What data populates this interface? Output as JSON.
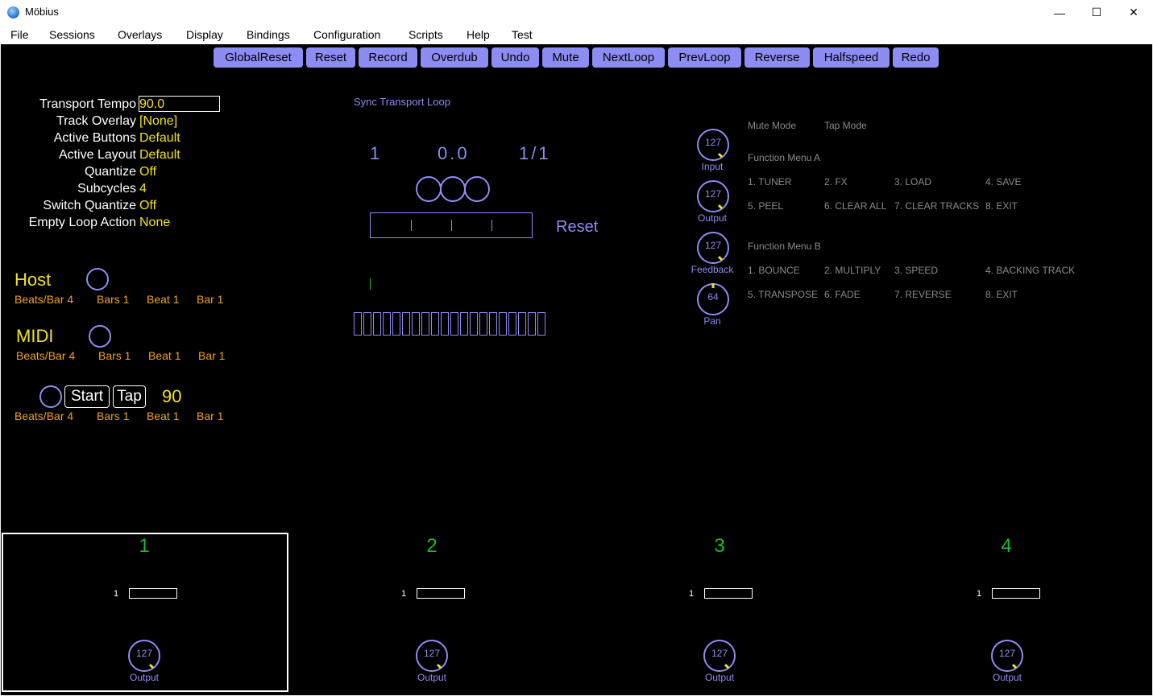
{
  "window": {
    "title": "Möbius",
    "minimize": "—",
    "maximize": "☐",
    "close": "✕"
  },
  "menu": [
    "File",
    "Sessions",
    "Overlays",
    "Display",
    "Bindings",
    "Configuration",
    "Scripts",
    "Help",
    "Test"
  ],
  "buttons": [
    "GlobalReset",
    "Reset",
    "Record",
    "Overdub",
    "Undo",
    "Mute",
    "NextLoop",
    "PrevLoop",
    "Reverse",
    "Halfspeed",
    "Redo"
  ],
  "params": [
    {
      "label": "Transport Tempo",
      "value": "90.0"
    },
    {
      "label": "Track Overlay",
      "value": "[None]"
    },
    {
      "label": "Active Buttons",
      "value": "Default"
    },
    {
      "label": "Active Layout",
      "value": "Default"
    },
    {
      "label": "Quantize",
      "value": "Off"
    },
    {
      "label": "Subcycles",
      "value": "4"
    },
    {
      "label": "Switch Quantize",
      "value": "Off"
    },
    {
      "label": "Empty Loop Action",
      "value": "None"
    }
  ],
  "sync": {
    "host": {
      "title": "Host",
      "beats_per_bar": "Beats/Bar 4",
      "bars": "Bars 1",
      "beat": "Beat 1",
      "bar": "Bar 1"
    },
    "midi": {
      "title": "MIDI",
      "beats_per_bar": "Beats/Bar 4",
      "bars": "Bars 1",
      "beat": "Beat 1",
      "bar": "Bar 1"
    },
    "transport": {
      "start": "Start",
      "tap": "Tap",
      "tempo": "90",
      "beats_per_bar": "Beats/Bar 4",
      "bars": "Bars 1",
      "beat": "Beat 1",
      "bar": "Bar 1"
    }
  },
  "loop_display": {
    "sync_label": "Sync Transport Loop",
    "loop_number": "1",
    "position": "0.0",
    "cycle": "1/1",
    "mode": "Reset"
  },
  "knobs": [
    {
      "value": "127",
      "label": "Input"
    },
    {
      "value": "127",
      "label": "Output"
    },
    {
      "value": "127",
      "label": "Feedback"
    },
    {
      "value": "64",
      "label": "Pan"
    }
  ],
  "modes": {
    "mute": "Mute Mode",
    "tap": "Tap Mode"
  },
  "function_menu_a": {
    "title": "Function Menu A",
    "items": [
      "1. TUNER",
      "2. FX",
      "3. LOAD",
      "4. SAVE",
      "5. PEEL",
      "6. CLEAR ALL",
      "7. CLEAR TRACKS",
      "8. EXIT"
    ]
  },
  "function_menu_b": {
    "title": "Function Menu B",
    "items": [
      "1. BOUNCE",
      "2. MULTIPLY",
      "3. SPEED",
      "4. BACKING TRACK",
      "5. TRANSPOSE",
      "6. FADE",
      "7. REVERSE",
      "8. EXIT"
    ]
  },
  "tracks": [
    {
      "number": "1",
      "loop": "1",
      "knob_value": "127",
      "knob_label": "Output",
      "selected": true
    },
    {
      "number": "2",
      "loop": "1",
      "knob_value": "127",
      "knob_label": "Output",
      "selected": false
    },
    {
      "number": "3",
      "loop": "1",
      "knob_value": "127",
      "knob_label": "Output",
      "selected": false
    },
    {
      "number": "4",
      "loop": "1",
      "knob_value": "127",
      "knob_label": "Output",
      "selected": false
    }
  ],
  "colors": {
    "accent": "#8d8cf2",
    "value": "#f2e21a",
    "info": "#f0a020",
    "track": "#1dbb2a",
    "knob_marker": "#f2e21a"
  }
}
